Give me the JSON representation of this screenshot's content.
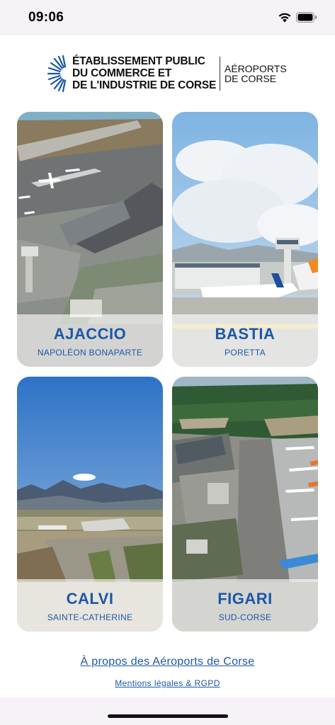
{
  "status_bar": {
    "time": "09:06",
    "icons": [
      "wifi-icon",
      "battery-icon"
    ]
  },
  "header": {
    "logo_icon": "sunburst-logo-icon",
    "org_line1": "ÉTABLISSEMENT PUBLIC",
    "org_line2": "DU COMMERCE ET",
    "org_line3": "DE L'INDUSTRIE DE CORSE",
    "brand_line1": "AÉROPORTS",
    "brand_line2": "DE CORSE"
  },
  "airports": [
    {
      "city": "AJACCIO",
      "airport": "NAPOLÉON BONAPARTE"
    },
    {
      "city": "BASTIA",
      "airport": "PORETTA"
    },
    {
      "city": "CALVI",
      "airport": "SAINTE-CATHERINE"
    },
    {
      "city": "FIGARI",
      "airport": "SUD-CORSE"
    }
  ],
  "footer": {
    "about_label": "À propos des Aéroports de Corse",
    "legal_label": "Mentions légales & RGPD"
  },
  "colors": {
    "accent": "#1c57a7",
    "background": "#f7f1f8",
    "content_background": "#ffffff"
  }
}
